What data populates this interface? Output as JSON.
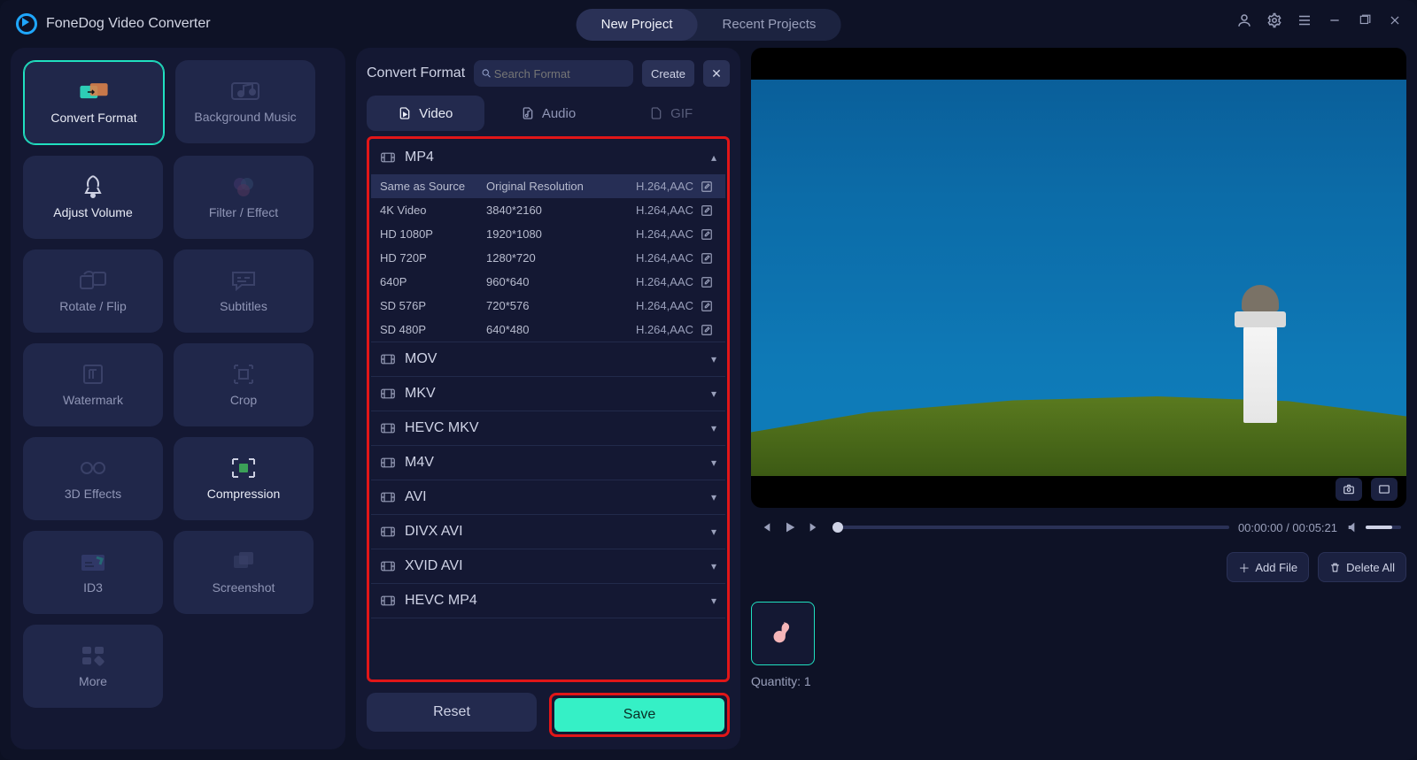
{
  "app": {
    "title": "FoneDog Video Converter"
  },
  "header": {
    "tabs": [
      {
        "label": "New Project",
        "active": true
      },
      {
        "label": "Recent Projects",
        "active": false
      }
    ]
  },
  "sidebar": {
    "tools": [
      {
        "id": "convert-format",
        "label": "Convert Format",
        "active": true
      },
      {
        "id": "background-music",
        "label": "Background Music"
      },
      {
        "id": "adjust-volume",
        "label": "Adjust Volume",
        "bright": true
      },
      {
        "id": "filter-effect",
        "label": "Filter / Effect"
      },
      {
        "id": "rotate-flip",
        "label": "Rotate / Flip"
      },
      {
        "id": "subtitles",
        "label": "Subtitles"
      },
      {
        "id": "watermark",
        "label": "Watermark"
      },
      {
        "id": "crop",
        "label": "Crop"
      },
      {
        "id": "3d-effects",
        "label": "3D Effects"
      },
      {
        "id": "compression",
        "label": "Compression",
        "bright": true
      },
      {
        "id": "id3",
        "label": "ID3"
      },
      {
        "id": "screenshot",
        "label": "Screenshot"
      },
      {
        "id": "more",
        "label": "More"
      }
    ]
  },
  "formatPanel": {
    "title": "Convert Format",
    "search_placeholder": "Search Format",
    "create_label": "Create",
    "tabs": [
      {
        "id": "video",
        "label": "Video",
        "active": true
      },
      {
        "id": "audio",
        "label": "Audio"
      },
      {
        "id": "gif",
        "label": "GIF",
        "dim": true
      }
    ],
    "groups": [
      {
        "name": "MP4",
        "expanded": true,
        "rows": [
          {
            "preset": "Same as Source",
            "res": "Original Resolution",
            "codec": "H.264,AAC",
            "selected": true
          },
          {
            "preset": "4K Video",
            "res": "3840*2160",
            "codec": "H.264,AAC"
          },
          {
            "preset": "HD 1080P",
            "res": "1920*1080",
            "codec": "H.264,AAC"
          },
          {
            "preset": "HD 720P",
            "res": "1280*720",
            "codec": "H.264,AAC"
          },
          {
            "preset": "640P",
            "res": "960*640",
            "codec": "H.264,AAC"
          },
          {
            "preset": "SD 576P",
            "res": "720*576",
            "codec": "H.264,AAC"
          },
          {
            "preset": "SD 480P",
            "res": "640*480",
            "codec": "H.264,AAC"
          }
        ]
      },
      {
        "name": "MOV"
      },
      {
        "name": "MKV"
      },
      {
        "name": "HEVC MKV"
      },
      {
        "name": "M4V"
      },
      {
        "name": "AVI"
      },
      {
        "name": "DIVX AVI"
      },
      {
        "name": "XVID AVI"
      },
      {
        "name": "HEVC MP4"
      }
    ],
    "reset_label": "Reset",
    "save_label": "Save"
  },
  "player": {
    "time_current": "00:00:00",
    "time_total": "00:05:21"
  },
  "files": {
    "add_label": "Add File",
    "delete_label": "Delete All",
    "quantity_label": "Quantity:",
    "quantity_value": "1"
  }
}
